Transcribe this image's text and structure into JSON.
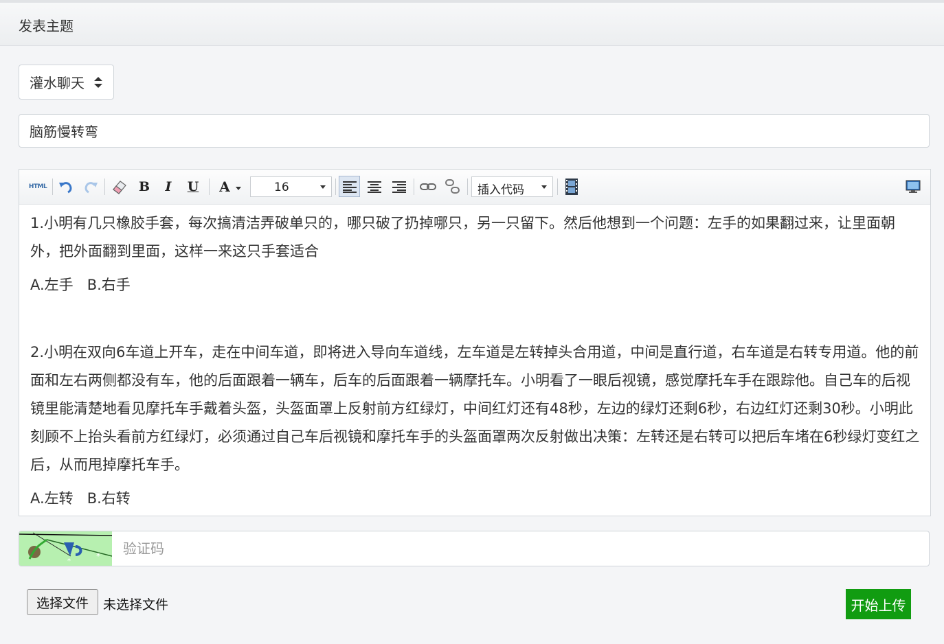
{
  "header": {
    "title": "发表主题"
  },
  "category_select": {
    "selected": "灌水聊天"
  },
  "title_field": {
    "value": "脑筋慢转弯"
  },
  "toolbar": {
    "html_label": "HTML",
    "font_size": "16",
    "insert_code_label": "插入代码",
    "bold_label": "B",
    "italic_label": "I",
    "underline_label": "U",
    "font_color_label": "A"
  },
  "editor": {
    "paragraphs": [
      "1.小明有几只橡胶手套，每次搞清洁弄破单只的，哪只破了扔掉哪只，另一只留下。然后他想到一个问题：左手的如果翻过来，让里面朝外，把外面翻到里面，这样一来这只手套适合",
      "A.左手   B.右手",
      "2.小明在双向6车道上开车，走在中间车道，即将进入导向车道线，左车道是左转掉头合用道，中间是直行道，右车道是右转专用道。他的前面和左右两侧都没有车，他的后面跟着一辆车，后车的后面跟着一辆摩托车。小明看了一眼后视镜，感觉摩托车手在跟踪他。自己车的后视镜里能清楚地看见摩托车手戴着头盔，头盔面罩上反射前方红绿灯，中间红灯还有48秒，左边的绿灯还剩6秒，右边红灯还剩30秒。小明此刻顾不上抬头看前方红绿灯，必须通过自己车后视镜和摩托车手的头盔面罩两次反射做出决策：左转还是右转可以把后车堵在6秒绿灯变红之后，从而甩掉摩托车手。",
      "A.左转   B.右转"
    ]
  },
  "captcha": {
    "placeholder": "验证码"
  },
  "file_upload": {
    "choose_label": "选择文件",
    "status": "未选择文件",
    "upload_label": "开始上传"
  },
  "colors": {
    "upload_button": "#119c11",
    "captcha_bg": "#b7f0b0"
  }
}
